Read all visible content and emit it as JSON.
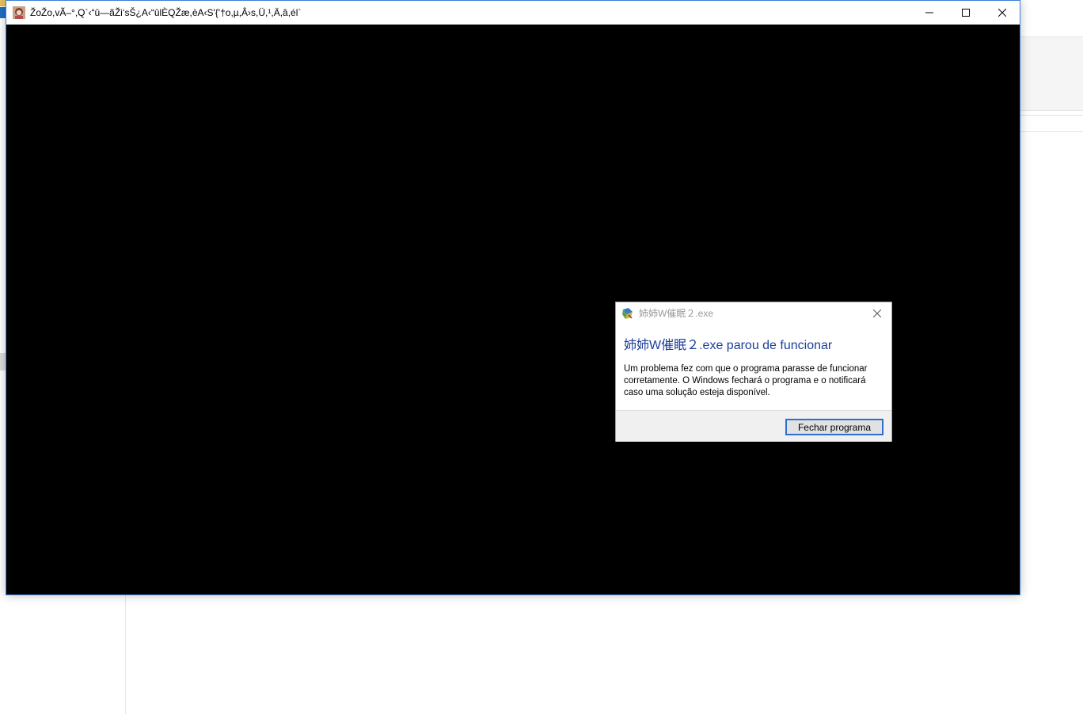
{
  "main_window": {
    "title": "ŽoŽo,vÃ–°,Q`‹“û—ãŽi‘sŠ¿A‹“ûlÈQŽæ,èA‹S'{'†o,µ,Â›s,Ü,¹,Ä,â,él`",
    "minimize_icon": "minimize-icon",
    "maximize_icon": "maximize-icon",
    "close_icon": "close-icon"
  },
  "dialog": {
    "title": "姉姉W催眠２.exe",
    "heading": "姉姉W催眠２.exe parou de funcionar",
    "message": "Um problema fez com que o programa parasse de funcionar corretamente. O Windows fechará o programa e o notificará caso uma solução esteja disponível.",
    "close_program_label": "Fechar programa"
  },
  "colors": {
    "heading_blue": "#1d3f9a",
    "window_border": "#3c7fd4",
    "button_focus": "#2b6fd0"
  }
}
